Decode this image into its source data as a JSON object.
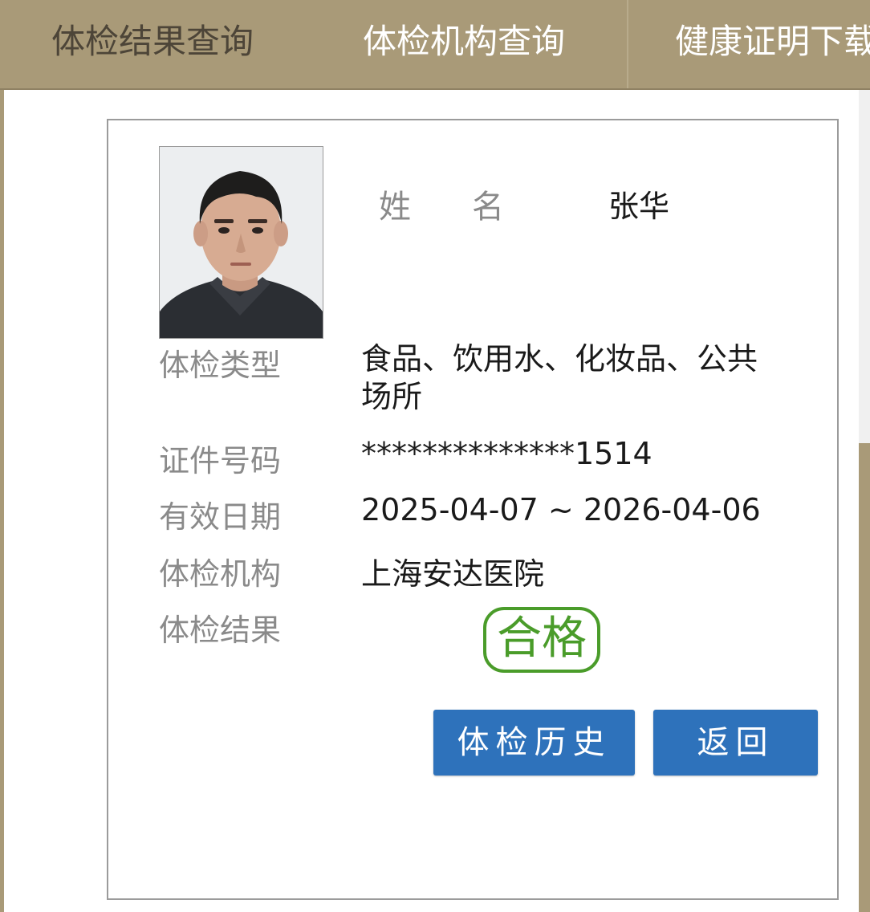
{
  "nav": {
    "tabs": [
      {
        "label": "体检结果查询",
        "active": true
      },
      {
        "label": "体检机构查询",
        "active": false
      },
      {
        "label": "健康证明下载",
        "active": false
      }
    ]
  },
  "record": {
    "name_label": "姓名",
    "name": "张华",
    "fields": [
      {
        "label": "体检类型",
        "value": "食品、饮用水、化妆品、公共场所"
      },
      {
        "label": "证件号码",
        "value": "**************1514"
      },
      {
        "label": "有效日期",
        "value": "2025-04-07 ~ 2026-04-06"
      },
      {
        "label": "体检机构",
        "value": "上海安达医院"
      },
      {
        "label": "体检结果",
        "value": "合格"
      }
    ]
  },
  "actions": {
    "history_label": "体检历史",
    "back_label": "返回"
  },
  "colors": {
    "nav_bg": "#a99a78",
    "pass_green": "#4a9c2a",
    "button_blue": "#2e72bb"
  }
}
